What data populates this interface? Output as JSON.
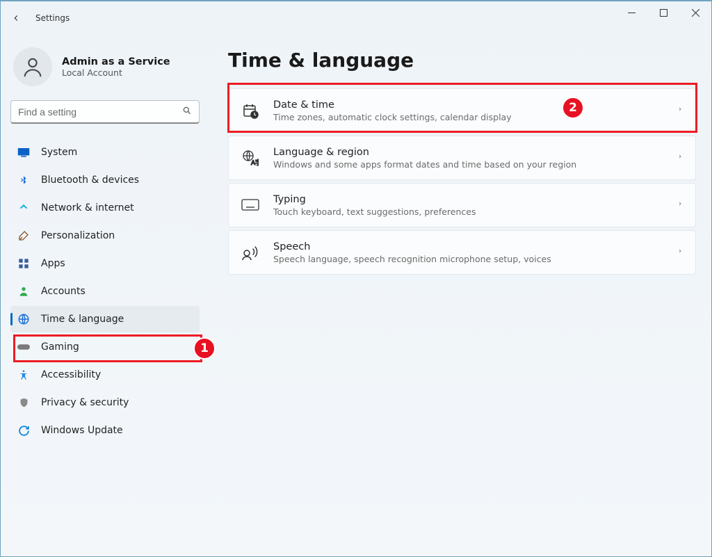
{
  "app": {
    "title": "Settings"
  },
  "account": {
    "name": "Admin as a Service",
    "sub": "Local Account"
  },
  "search": {
    "placeholder": "Find a setting"
  },
  "sidebar": {
    "items": [
      {
        "icon": "monitor-icon",
        "label": "System",
        "selected": false
      },
      {
        "icon": "bluetooth-icon",
        "label": "Bluetooth & devices",
        "selected": false
      },
      {
        "icon": "wifi-icon",
        "label": "Network & internet",
        "selected": false
      },
      {
        "icon": "brush-icon",
        "label": "Personalization",
        "selected": false
      },
      {
        "icon": "apps-icon",
        "label": "Apps",
        "selected": false
      },
      {
        "icon": "person-icon",
        "label": "Accounts",
        "selected": false
      },
      {
        "icon": "globe-icon",
        "label": "Time & language",
        "selected": true
      },
      {
        "icon": "gamepad-icon",
        "label": "Gaming",
        "selected": false
      },
      {
        "icon": "access-icon",
        "label": "Accessibility",
        "selected": false
      },
      {
        "icon": "shield-icon",
        "label": "Privacy & security",
        "selected": false
      },
      {
        "icon": "update-icon",
        "label": "Windows Update",
        "selected": false
      }
    ]
  },
  "page": {
    "title": "Time & language",
    "cards": [
      {
        "icon": "calendar-clock-icon",
        "title": "Date & time",
        "desc": "Time zones, automatic clock settings, calendar display"
      },
      {
        "icon": "language-icon",
        "title": "Language & region",
        "desc": "Windows and some apps format dates and time based on your region"
      },
      {
        "icon": "keyboard-icon",
        "title": "Typing",
        "desc": "Touch keyboard, text suggestions, preferences"
      },
      {
        "icon": "speech-icon",
        "title": "Speech",
        "desc": "Speech language, speech recognition microphone setup, voices"
      }
    ]
  },
  "annotations": {
    "label1": "1",
    "label2": "2"
  }
}
